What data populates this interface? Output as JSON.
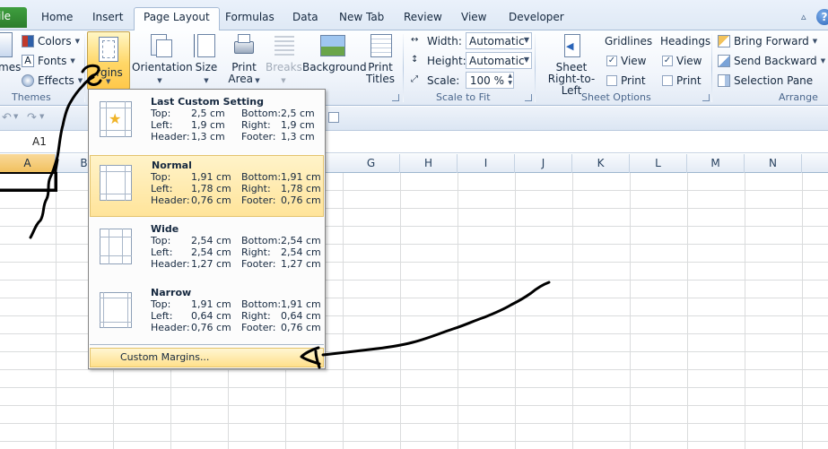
{
  "tabs": {
    "file": "ile",
    "items": [
      "Home",
      "Insert",
      "Page Layout",
      "Formulas",
      "Data",
      "New Tab",
      "Review",
      "View",
      "Developer"
    ],
    "active": "Page Layout"
  },
  "ribbon": {
    "themes": {
      "themes_partial": "mes",
      "colors": "Colors",
      "fonts": "Fonts",
      "effects": "Effects",
      "group_label": "Themes"
    },
    "page_setup": {
      "margins": "rgins",
      "orientation": "Orientation",
      "size": "Size",
      "print_area_1": "Print",
      "print_area_2": "Area",
      "breaks": "Breaks",
      "background": "Background",
      "print_titles_1": "Print",
      "print_titles_2": "Titles"
    },
    "scale_to_fit": {
      "width_label": "Width:",
      "width_value": "Automatic",
      "height_label": "Height:",
      "height_value": "Automatic",
      "scale_label": "Scale:",
      "scale_value": "100 %",
      "group_label": "Scale to Fit"
    },
    "sheet_options": {
      "sheet_rtl_1": "Sheet",
      "sheet_rtl_2": "Right-to-Left",
      "gridlines": "Gridlines",
      "headings": "Headings",
      "view": "View",
      "print": "Print",
      "gridlines_view_checked": true,
      "headings_view_checked": true,
      "group_label": "Sheet Options"
    },
    "arrange": {
      "bring_forward": "Bring Forward",
      "send_backward": "Send Backward",
      "selection_pane": "Selection Pane",
      "group_label": "Arrange"
    }
  },
  "formula_bar": {
    "name_box": "A1"
  },
  "columns": [
    "A",
    "B",
    "G",
    "H",
    "I",
    "J",
    "K",
    "L",
    "M",
    "N"
  ],
  "margins_menu": {
    "items": [
      {
        "title": "Last Custom Setting",
        "top_label": "Top:",
        "top": "2,5 cm",
        "bottom_label": "Bottom:",
        "bottom": "2,5 cm",
        "left_label": "Left:",
        "left": "1,9 cm",
        "right_label": "Right:",
        "right": "1,9 cm",
        "header_label": "Header:",
        "header": "1,3 cm",
        "footer_label": "Footer:",
        "footer": "1,3 cm"
      },
      {
        "title": "Normal",
        "top_label": "Top:",
        "top": "1,91 cm",
        "bottom_label": "Bottom:",
        "bottom": "1,91 cm",
        "left_label": "Left:",
        "left": "1,78 cm",
        "right_label": "Right:",
        "right": "1,78 cm",
        "header_label": "Header:",
        "header": "0,76 cm",
        "footer_label": "Footer:",
        "footer": "0,76 cm"
      },
      {
        "title": "Wide",
        "top_label": "Top:",
        "top": "2,54 cm",
        "bottom_label": "Bottom:",
        "bottom": "2,54 cm",
        "left_label": "Left:",
        "left": "2,54 cm",
        "right_label": "Right:",
        "right": "2,54 cm",
        "header_label": "Header:",
        "header": "1,27 cm",
        "footer_label": "Footer:",
        "footer": "1,27 cm"
      },
      {
        "title": "Narrow",
        "top_label": "Top:",
        "top": "1,91 cm",
        "bottom_label": "Bottom:",
        "bottom": "1,91 cm",
        "left_label": "Left:",
        "left": "0,64 cm",
        "right_label": "Right:",
        "right": "0,64 cm",
        "header_label": "Header:",
        "header": "0,76 cm",
        "footer_label": "Footer:",
        "footer": "0,76 cm"
      }
    ],
    "custom_margins": "Custom Margins..."
  },
  "colors": {
    "accent_highlight": "#ffd767",
    "file_tab": "#2c7d2c",
    "annotation_ink": "#000000"
  }
}
